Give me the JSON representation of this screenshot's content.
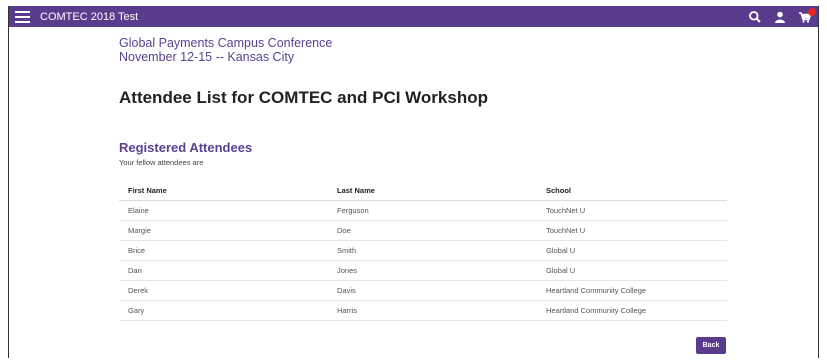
{
  "app": {
    "title": "COMTEC 2018 Test",
    "accent_color": "#5a3c8c",
    "icons": [
      "search-icon",
      "user-icon",
      "cart-icon"
    ]
  },
  "conference": {
    "name": "Global Payments Campus Conference",
    "dates": "November 12-15   -- Kansas City"
  },
  "page_title": "Attendee List for COMTEC and PCI Workshop",
  "section": {
    "title": "Registered Attendees",
    "subtitle": "Your fellow attendees are"
  },
  "table": {
    "headers": [
      "First Name",
      "Last Name",
      "School"
    ],
    "rows": [
      [
        "Elaine",
        "Ferguson",
        "TouchNet U"
      ],
      [
        "Margie",
        "Doe",
        "TouchNet U"
      ],
      [
        "Brice",
        "Smith",
        "Global U"
      ],
      [
        "Dan",
        "Jones",
        "Global U"
      ],
      [
        "Derek",
        "Davis",
        "Heartland Community College"
      ],
      [
        "Gary",
        "Harris",
        "Heartland Community College"
      ]
    ]
  },
  "back_label": "Back"
}
